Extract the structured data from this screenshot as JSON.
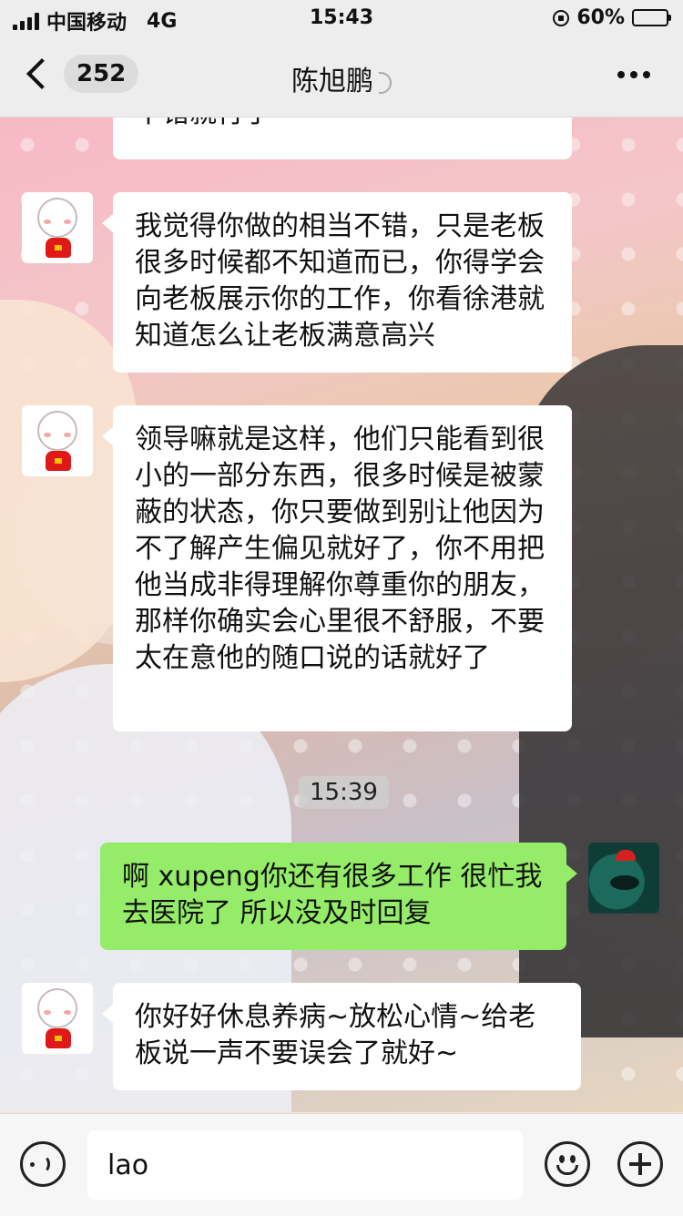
{
  "status_bar": {
    "carrier": "中国移动",
    "network": "4G",
    "time": "15:43",
    "battery_percent": "60%",
    "battery_level": 0.6
  },
  "nav": {
    "unread_count": "252",
    "title": "陈旭鹏"
  },
  "messages": [
    {
      "sender": "contact",
      "text": "不错就行了"
    },
    {
      "sender": "contact",
      "text": "我觉得你做的相当不错，只是老板很多时候都不知道而已，你得学会向老板展示你的工作，你看徐港就知道怎么让老板满意高兴"
    },
    {
      "sender": "contact",
      "text": "领导嘛就是这样，他们只能看到很小的一部分东西，很多时候是被蒙蔽的状态，你只要做到别让他因为不了解产生偏见就好了，你不用把他当成非得理解你尊重你的朋友，那样你确实会心里很不舒服，不要太在意他的随口说的话就好了"
    },
    {
      "sender": "me",
      "text": "啊 xupeng你还有很多工作 很忙我去医院了 所以没及时回复"
    },
    {
      "sender": "contact",
      "text": "你好好休息养病~放松心情~给老板说一声不要误会了就好~"
    }
  ],
  "timestamp": "15:39",
  "input": {
    "value": "lao"
  }
}
